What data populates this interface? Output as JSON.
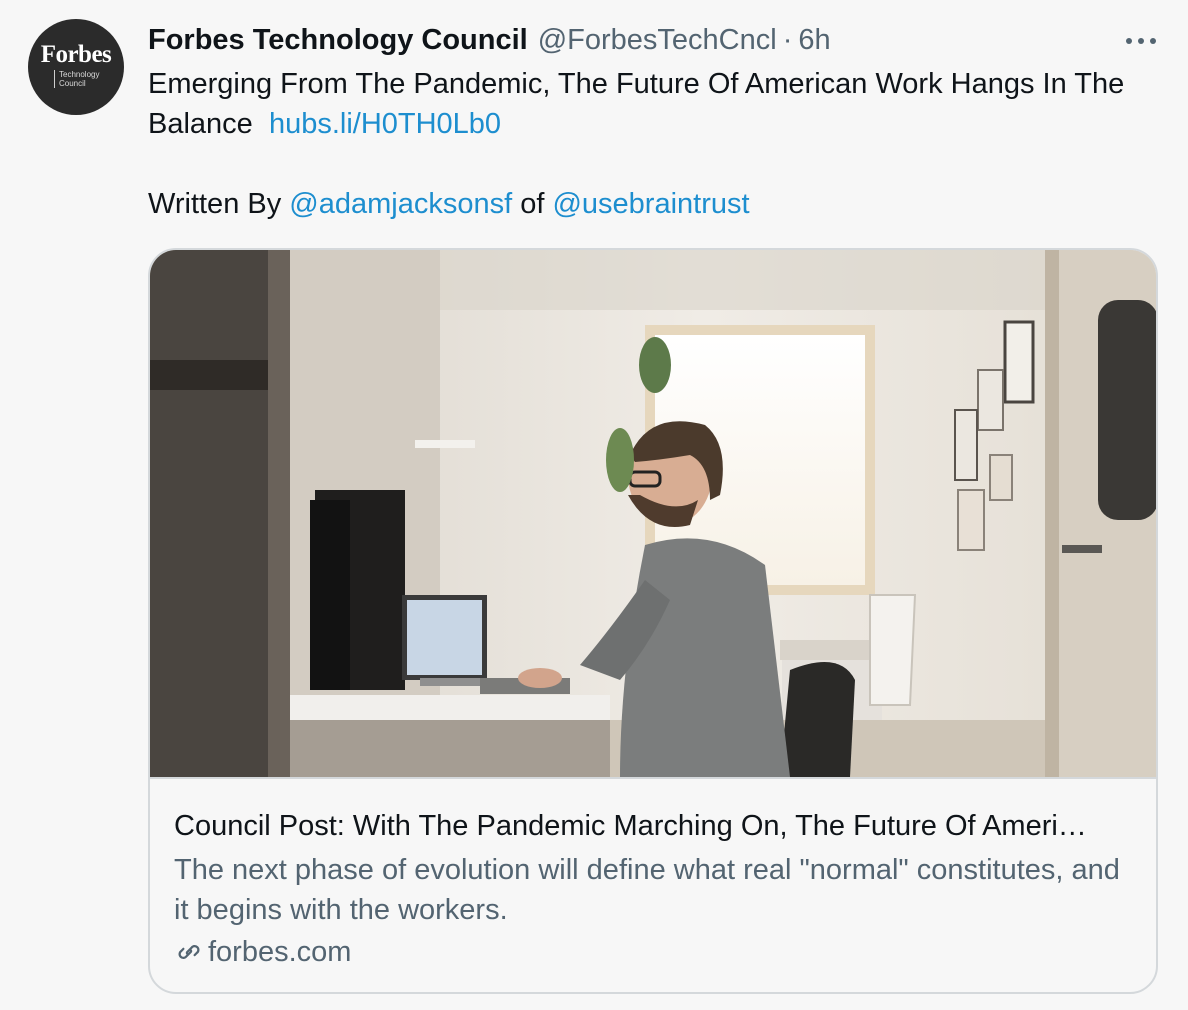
{
  "account": {
    "avatar_logo": "Forbes",
    "avatar_sub_line1": "Technology",
    "avatar_sub_line2": "Council",
    "display_name": "Forbes Technology Council",
    "handle": "@ForbesTechCncl",
    "separator": "·",
    "time": "6h"
  },
  "tweet": {
    "text": "Emerging From The Pandemic, The Future Of American Work Hangs In The Balance",
    "link": "hubs.li/H0TH0Lb0",
    "written_by": "Written By",
    "mention_author": "@adamjacksonsf",
    "of_word": "of",
    "mention_org": "@usebraintrust"
  },
  "card": {
    "image_icon": "photo-man-at-desk",
    "title": "Council Post: With The Pandemic Marching On, The Future Of Ameri…",
    "description": "The next phase of evolution will define what real \"normal\" constitutes, and it begins with the workers.",
    "domain": "forbes.com",
    "domain_icon": "link-icon"
  },
  "icons": {
    "more": "more-horizontal-icon"
  },
  "colors": {
    "background": "#f7f7f7",
    "link": "#1d8ecf",
    "secondary_text": "#536471",
    "primary_text": "#0f1419",
    "card_border": "#d4d8db"
  }
}
